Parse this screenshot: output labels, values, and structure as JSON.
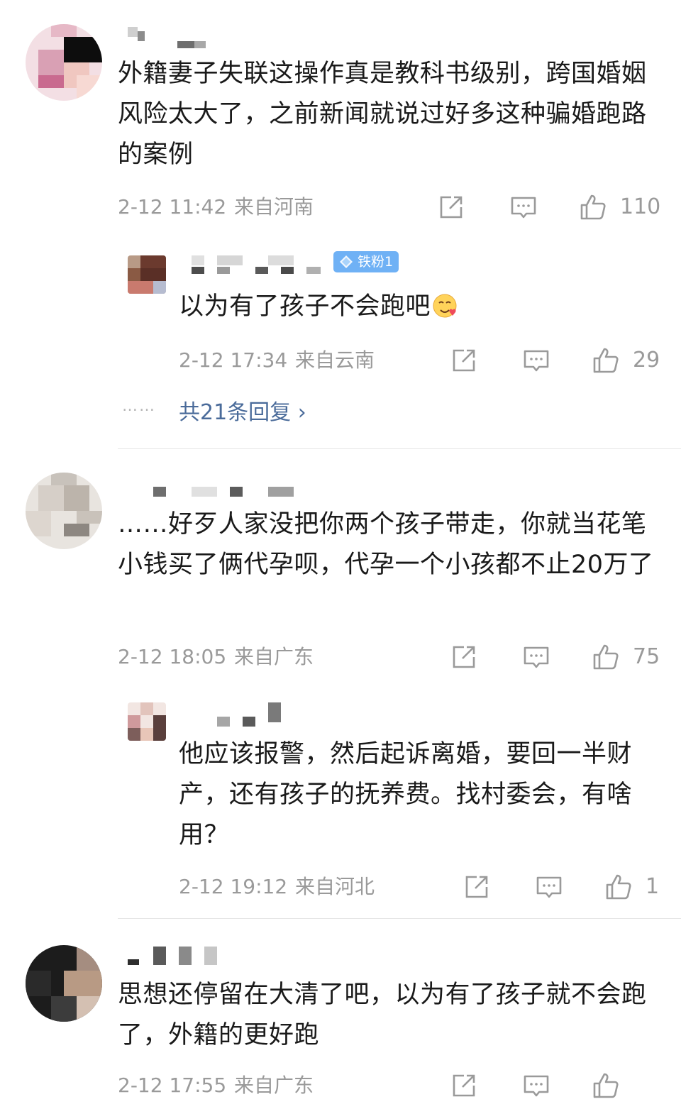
{
  "comments": [
    {
      "text": "外籍妻子失联这操作真是教科书级别，跨国婚姻风险太大了，之前新闻就说过好多这种骗婚跑路的案例",
      "time": "2-12 11:42",
      "location": "来自河南",
      "likes": "110",
      "reply": {
        "badge": "铁粉1",
        "text": "以为有了孩子不会跑吧",
        "emoji": "heart-face-emoji",
        "time": "2-12 17:34",
        "location": "来自云南",
        "likes": "29",
        "more_replies": "共21条回复 ›",
        "more_dots": "……"
      }
    },
    {
      "text": "……好歹人家没把你两个孩子带走，你就当花笔小钱买了俩代孕呗，代孕一个小孩都不止20万了",
      "time": "2-12 18:05",
      "location": "来自广东",
      "likes": "75",
      "reply": {
        "text": "他应该报警，然后起诉离婚，要回一半财产，还有孩子的抚养费。找村委会，有啥用？",
        "time": "2-12 19:12",
        "location": "来自河北",
        "likes": "1"
      }
    },
    {
      "text": "思想还停留在大清了吧，以为有了孩子就不会跑了，外籍的更好跑",
      "time": "2-12 17:55",
      "location": "来自广东"
    }
  ],
  "icons": {
    "share": "share-icon",
    "reply": "comment-icon",
    "like": "thumbs-up-icon"
  },
  "colors": {
    "text": "#1a1a1a",
    "meta": "#9a9a9a",
    "link": "#4a6b9a",
    "badge": "#6fb1f5"
  }
}
